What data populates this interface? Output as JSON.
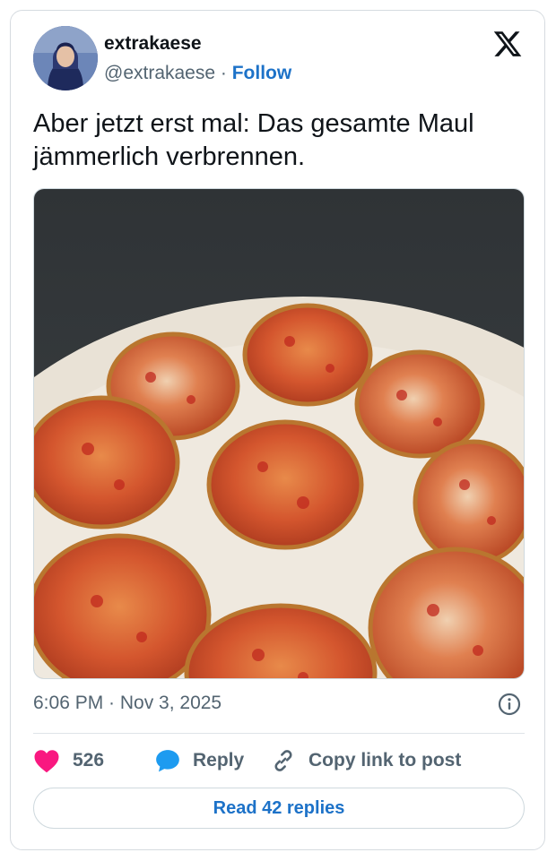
{
  "post": {
    "author": {
      "display_name": "extrakaese",
      "handle": "@extrakaese",
      "separator": "·",
      "follow_label": "Follow"
    },
    "text": "Aber jetzt erst mal: Das gesamte Maul jämmerlich verbrennen.",
    "timestamp": "6:06 PM · Nov 3, 2025",
    "likes_count": "526",
    "reply_label": "Reply",
    "copy_link_label": "Copy link to post",
    "read_replies_label": "Read 42 replies"
  },
  "icons": {
    "platform": "x-logo-icon",
    "info": "info-icon",
    "like": "heart-icon",
    "reply": "speech-bubble-icon",
    "copy_link": "link-icon"
  },
  "colors": {
    "like": "#f91880",
    "reply": "#1d9bf0",
    "link_text": "#1d72c8",
    "secondary_text": "#536471"
  }
}
